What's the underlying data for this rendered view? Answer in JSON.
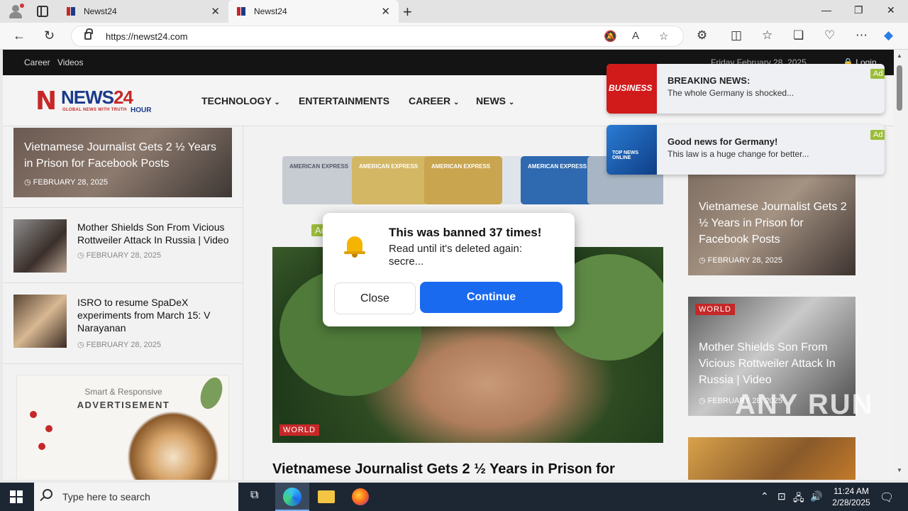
{
  "browser": {
    "tabs": [
      {
        "title": "Newst24",
        "active": false
      },
      {
        "title": "Newst24",
        "active": true
      }
    ],
    "new_tab_icon": "+",
    "url": "https://newst24.com"
  },
  "site": {
    "top_links": [
      "Career",
      "Videos"
    ],
    "date": "Friday February 28, 2025",
    "login": "Login",
    "logo": {
      "word": "NEWS",
      "num": "24",
      "tagline": "GLOBAL NEWS WITH TRUTH",
      "hour": "HOUR"
    },
    "menu": [
      {
        "label": "TECHNOLOGY",
        "caret": true
      },
      {
        "label": "ENTERTAINMENTS",
        "caret": false
      },
      {
        "label": "CAREER",
        "caret": true
      },
      {
        "label": "NEWS",
        "caret": true
      }
    ]
  },
  "left": {
    "hero": {
      "title": "Vietnamese Journalist Gets 2 ½ Years in Prison for Facebook Posts",
      "date": "FEBRUARY 28, 2025"
    },
    "items": [
      {
        "title": "Mother Shields Son From Vicious Rottweiler Attack In Russia | Video",
        "date": "FEBRUARY 28, 2025"
      },
      {
        "title": "ISRO to resume SpaDeX experiments from March 15: V Narayanan",
        "date": "FEBRUARY 28, 2025"
      }
    ],
    "ad": {
      "line1": "Smart & Responsive",
      "line2": "ADVERTISEMENT"
    }
  },
  "center": {
    "card_labels": [
      "AMERICAN EXPRESS",
      "AMERICAN EXPRESS",
      "AMERICAN EXPRESS",
      "AMERICAN EXPRESS"
    ],
    "badge": "WORLD",
    "headline": "Vietnamese Journalist Gets 2 ½ Years in Prison for"
  },
  "right": {
    "cards": [
      {
        "badge": "",
        "title": "Vietnamese Journalist Gets 2 ½ Years in Prison for Facebook Posts",
        "date": "FEBRUARY 28, 2025"
      },
      {
        "badge": "WORLD",
        "title": "Mother Shields Son From Vicious Rottweiler Attack In Russia | Video",
        "date": "FEBRUARY 28, 2025"
      }
    ]
  },
  "notifications": [
    {
      "icon": "BUSINESS",
      "title": "BREAKING NEWS:",
      "text": "The whole Germany is shocked...",
      "ad": "Ad"
    },
    {
      "icon": "TOP NEWS ONLINE",
      "title": "Good news for Germany!",
      "text": "This law is a huge change for better...",
      "ad": "Ad"
    }
  ],
  "modal": {
    "ad": "Ad",
    "title": "This was banned 37 times!",
    "text": "Read until it's deleted again: secre...",
    "close": "Close",
    "continue": "Continue"
  },
  "watermark": "ANY RUN",
  "taskbar": {
    "search_placeholder": "Type here to search",
    "time": "11:24 AM",
    "date": "2/28/2025"
  },
  "colors": {
    "accent": "#1a6af0",
    "brand_red": "#c62828",
    "brand_blue": "#1a3a8a",
    "ad_green": "#9bbd3a"
  }
}
